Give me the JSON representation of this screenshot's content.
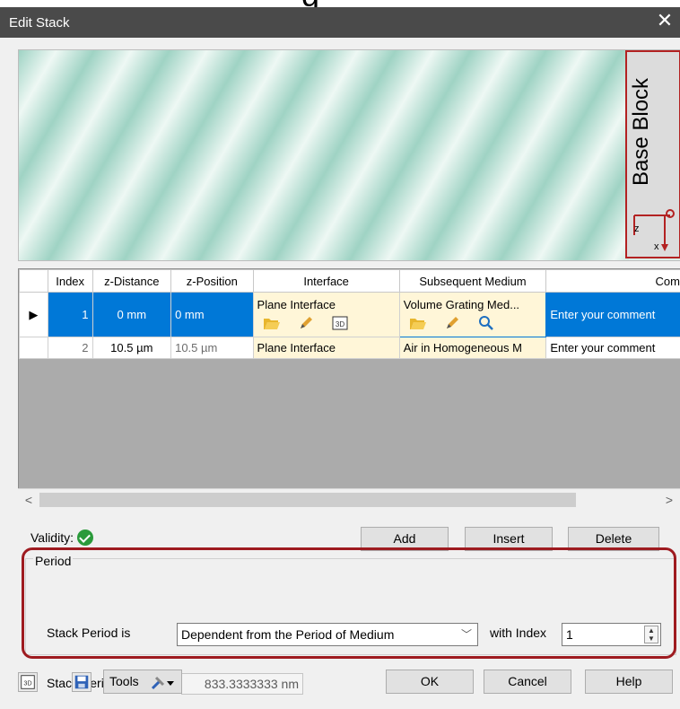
{
  "window": {
    "title": "Edit Stack",
    "top_fragment": "g",
    "close_glyph": "✕"
  },
  "preview": {
    "block_label": "Base Block",
    "axis_z": "z",
    "axis_x": "x"
  },
  "grid": {
    "columns": [
      "",
      "Index",
      "z-Distance",
      "z-Position",
      "Interface",
      "Subsequent Medium",
      "Com"
    ],
    "rows": [
      {
        "marker": "▶",
        "index": "1",
        "z_distance": "0 mm",
        "z_position": "0 mm",
        "interface": "Plane Interface",
        "medium": "Volume Grating Med...",
        "comment": "Enter your comment"
      },
      {
        "marker": "",
        "index": "2",
        "z_distance": "10.5 µm",
        "z_position": "10.5 µm",
        "interface": "Plane Interface",
        "medium": "Air in Homogeneous M",
        "comment": "Enter your comment"
      }
    ],
    "scroll_left": "<",
    "scroll_right": ">"
  },
  "validity": {
    "label": "Validity:"
  },
  "row_buttons": {
    "add": "Add",
    "insert": "Insert",
    "delete": "Delete"
  },
  "period": {
    "legend": "Period",
    "stack_period_is_label": "Stack Period is",
    "mode_value": "Dependent from the Period of Medium",
    "with_index_label": "with Index",
    "index_value": "1",
    "stack_period_label": "Stack Period",
    "stack_period_value": "833.3333333 nm"
  },
  "footer": {
    "tools_label": "Tools",
    "ok": "OK",
    "cancel": "Cancel",
    "help": "Help"
  },
  "colors": {
    "selection": "#0078d7",
    "highlight_frame": "#9e1b20",
    "block_frame": "#b32222",
    "interface_cell": "#fff6d8",
    "validity_ok": "#2a9a3a"
  }
}
